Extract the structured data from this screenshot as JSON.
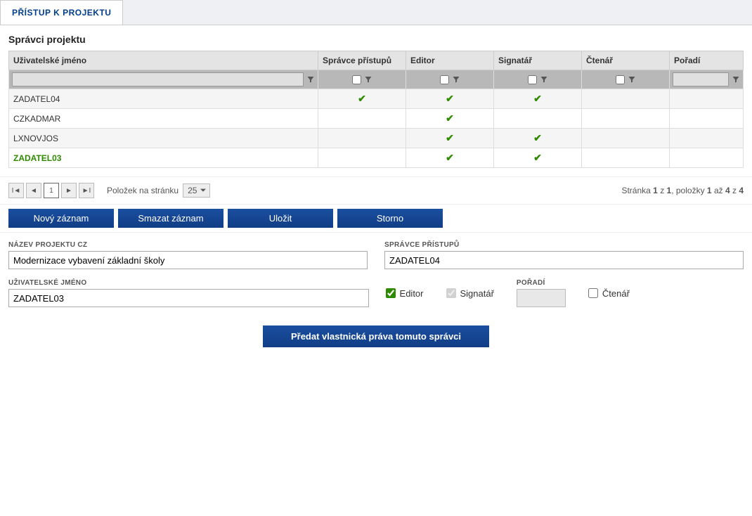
{
  "tab": {
    "label": "PŘÍSTUP K PROJEKTU"
  },
  "section": {
    "title": "Správci projektu"
  },
  "columns": {
    "username": "Uživatelské jméno",
    "accessAdmin": "Správce přístupů",
    "editor": "Editor",
    "signatory": "Signatář",
    "reader": "Čtenář",
    "order": "Pořadí"
  },
  "rows": [
    {
      "username": "ZADATEL04",
      "accessAdmin": true,
      "editor": true,
      "signatory": true,
      "reader": false,
      "order": ""
    },
    {
      "username": "CZKADMAR",
      "accessAdmin": false,
      "editor": true,
      "signatory": false,
      "reader": false,
      "order": ""
    },
    {
      "username": "LXNOVJOS",
      "accessAdmin": false,
      "editor": true,
      "signatory": true,
      "reader": false,
      "order": ""
    },
    {
      "username": "ZADATEL03",
      "accessAdmin": false,
      "editor": true,
      "signatory": true,
      "reader": false,
      "order": "",
      "selected": true
    }
  ],
  "pager": {
    "current": "1",
    "itemsPerPageLabel": "Položek na stránku",
    "itemsPerPage": "25",
    "summary_p1": "Stránka ",
    "summary_b1": "1",
    "summary_p2": " z ",
    "summary_b2": "1",
    "summary_p3": ", položky ",
    "summary_b3": "1",
    "summary_p4": " až ",
    "summary_b4": "4",
    "summary_p5": " z ",
    "summary_b5": "4"
  },
  "actions": {
    "new": "Nový záznam",
    "delete": "Smazat záznam",
    "save": "Uložit",
    "cancel": "Storno"
  },
  "form": {
    "projectNameLabel": "NÁZEV PROJEKTU CZ",
    "projectName": "Modernizace vybavení základní školy",
    "accessAdminLabel": "SPRÁVCE PŘÍSTUPŮ",
    "accessAdmin": "ZADATEL04",
    "usernameLabel": "UŽIVATELSKÉ JMÉNO",
    "username": "ZADATEL03",
    "editorLabel": "Editor",
    "signatoryLabel": "Signatář",
    "orderLabel": "POŘADÍ",
    "readerLabel": "Čtenář",
    "editorChecked": true,
    "signatoryChecked": true,
    "readerChecked": false
  },
  "transfer": {
    "label": "Předat vlastnická práva tomuto správci"
  }
}
